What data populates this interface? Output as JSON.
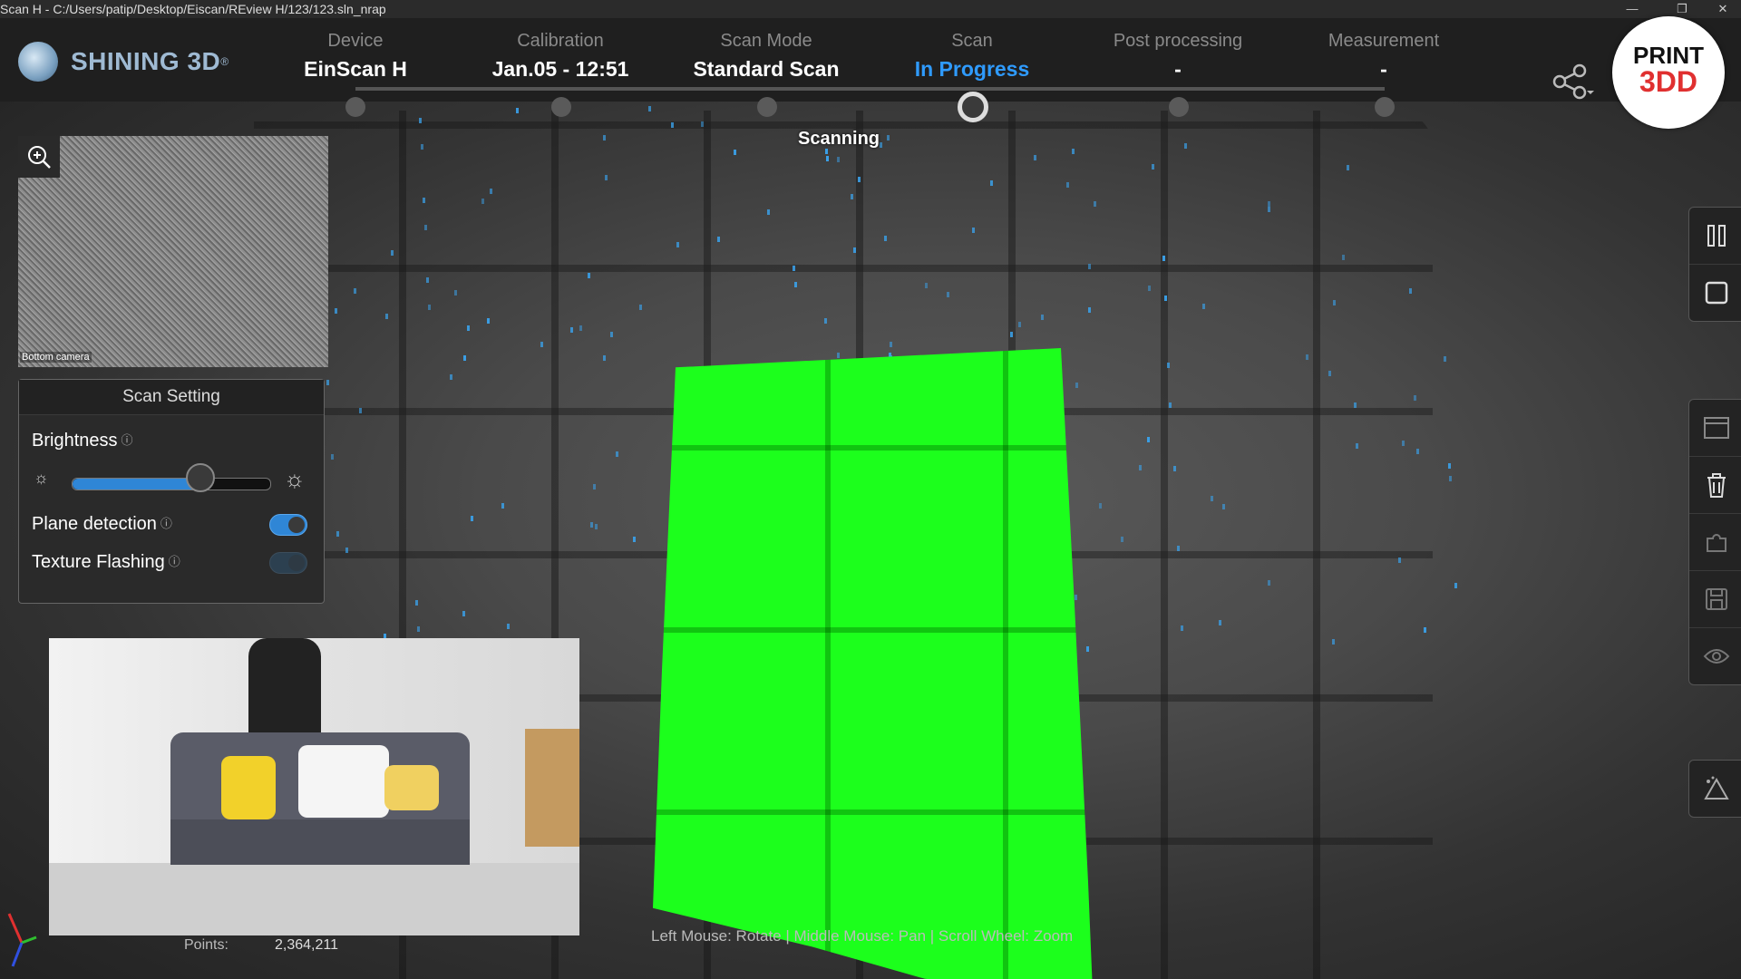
{
  "titlebar": {
    "title": "Scan H  -  C:/Users/patip/Desktop/Eiscan/REview H/123/123.sln_nrap",
    "minimize": "—",
    "restore": "❐",
    "close": "✕"
  },
  "brand": {
    "logo_text": "SHINING 3D",
    "logo_mark": "®"
  },
  "steps": [
    {
      "label": "Device",
      "value": "EinScan H"
    },
    {
      "label": "Calibration",
      "value": "Jan.05 - 12:51"
    },
    {
      "label": "Scan Mode",
      "value": "Standard Scan"
    },
    {
      "label": "Scan",
      "value": "In Progress"
    },
    {
      "label": "Post processing",
      "value": "-"
    },
    {
      "label": "Measurement",
      "value": "-"
    }
  ],
  "badge": {
    "line1": "PRINT",
    "line2": "3DD"
  },
  "status": {
    "scanning": "Scanning"
  },
  "camera": {
    "label": "Bottom camera"
  },
  "scan_setting": {
    "title": "Scan Setting",
    "brightness_label": "Brightness",
    "brightness_level": 0.65,
    "plane_detection_label": "Plane detection",
    "plane_detection_on": true,
    "texture_flashing_label": "Texture Flashing",
    "texture_flashing_on": false,
    "info_glyph": "ⓘ"
  },
  "footer": {
    "points_label": "Points:",
    "points_value": "2,364,211",
    "mouse_hint": "Left Mouse: Rotate | Middle Mouse: Pan | Scroll Wheel: Zoom"
  },
  "colors": {
    "accent": "#2f9bff",
    "scan_green": "#21ff21",
    "speck_blue": "#3aa0e8"
  },
  "icons": {
    "zoom": "zoom-in-icon",
    "share": "share-icon",
    "pause": "pause-icon",
    "stop": "stop-icon",
    "window": "window-icon",
    "delete": "trash-icon",
    "puzzle": "puzzle-icon",
    "save": "save-icon",
    "view": "eye-icon",
    "mesh": "mesh-icon"
  }
}
